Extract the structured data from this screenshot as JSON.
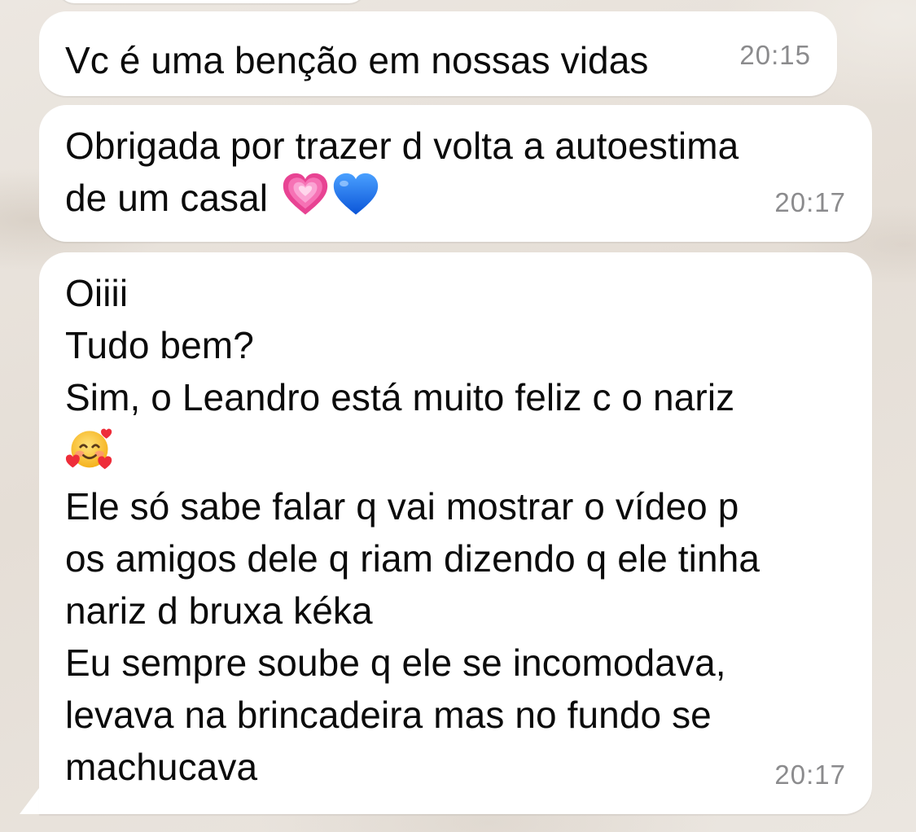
{
  "messages": [
    {
      "text": "Vc é uma benção em nossas vidas",
      "time": "20:15"
    },
    {
      "line1": "Obrigada por trazer d volta a autoestima",
      "line2": "de um casal",
      "emojis": [
        "growing-heart-icon",
        "blue-heart-icon"
      ],
      "time": "20:17"
    },
    {
      "lines_before_emoji": [
        "Oiiii",
        "Tudo bem?",
        "Sim, o Leandro está muito feliz c o nariz"
      ],
      "emoji": "smiling-face-with-hearts-icon",
      "lines_after_emoji": [
        "Ele só sabe falar q vai mostrar o vídeo p",
        "os amigos dele q riam dizendo q ele tinha",
        "nariz d bruxa kéka",
        "Eu sempre soube q ele se incomodava,",
        "levava na brincadeira mas no fundo se",
        "machucava"
      ],
      "time": "20:17"
    }
  ],
  "colors": {
    "bubble": "#ffffff",
    "text": "#0b0b0b",
    "timestamp": "#8b8b8d",
    "wallpaper": "#e9e3dc",
    "pink_heart": "#f04fa0",
    "blue_heart": "#1f6ff0"
  }
}
